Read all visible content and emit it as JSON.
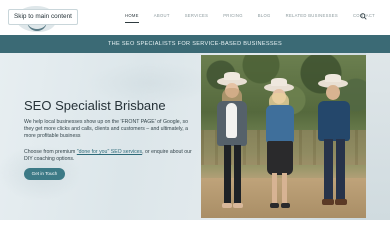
{
  "header": {
    "skip_link": "Skip to main content",
    "nav": [
      "HOME",
      "ABOUT",
      "SERVICES",
      "PRICING",
      "BLOG",
      "RELATED BUSINESSES",
      "CONTACT"
    ],
    "active_nav": "HOME",
    "search_icon": "search-icon"
  },
  "banner": {
    "text": "THE SEO SPECIALISTS FOR SERVICE-BASED BUSINESSES"
  },
  "hero": {
    "title": "SEO Specialist Brisbane",
    "paragraph1": "We help local businesses show up on the 'FRONT PAGE' of Google, so they get more clicks and calls, clients and customers – and ultimately, a more profitable business",
    "paragraph2_before": "Choose from premium ",
    "paragraph2_link": "\"done for you\" SEO services",
    "paragraph2_after": ", or enquire about our DIY coaching options.",
    "cta_label": "Get in Touch"
  },
  "colors": {
    "banner": "#3b6a75",
    "cta": "#3d7a86",
    "text": "#263238"
  }
}
